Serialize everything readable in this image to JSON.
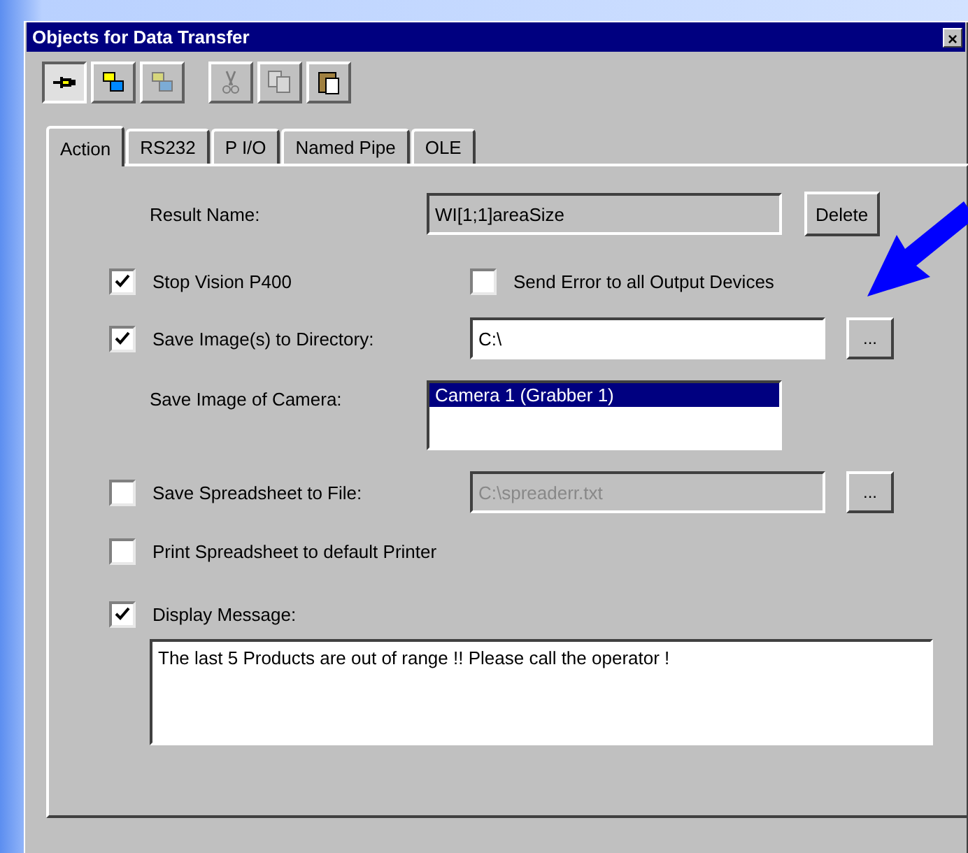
{
  "window": {
    "title": "Objects for Data Transfer",
    "close": "×"
  },
  "toolbar": [
    {
      "kind": "pin",
      "pressed": true,
      "disabled": false
    },
    {
      "kind": "tool",
      "pressed": false,
      "disabled": false
    },
    {
      "kind": "tool",
      "pressed": false,
      "disabled": true
    },
    {
      "kind": "cut",
      "pressed": false,
      "disabled": true
    },
    {
      "kind": "copy",
      "pressed": false,
      "disabled": true
    },
    {
      "kind": "paste",
      "pressed": false,
      "disabled": false
    }
  ],
  "tabs": [
    {
      "label": "Action",
      "selected": true
    },
    {
      "label": "RS232",
      "selected": false
    },
    {
      "label": "P I/O",
      "selected": false
    },
    {
      "label": "Named Pipe",
      "selected": false
    },
    {
      "label": "OLE",
      "selected": false
    }
  ],
  "result_name": {
    "label": "Result Name:",
    "value": "WI[1;1]areaSize",
    "button": "Delete"
  },
  "stop_vision": {
    "label": "Stop Vision P400",
    "checked": true
  },
  "send_error": {
    "label": "Send Error to all Output Devices",
    "checked": false
  },
  "save_images": {
    "label": "Save Image(s) to Directory:",
    "checked": true,
    "value": "C:\\",
    "disabled": false,
    "button": "..."
  },
  "camera": {
    "label": "Save Image of Camera:",
    "items": [
      {
        "label": "Camera 1  (Grabber 1)",
        "selected": true
      }
    ]
  },
  "save_spreadsheet": {
    "label": "Save Spreadsheet to File:",
    "checked": false,
    "value": "C:\\spreaderr.txt",
    "disabled": true,
    "button": "..."
  },
  "print_spreadsheet": {
    "label": "Print Spreadsheet to default Printer",
    "checked": false
  },
  "display_message": {
    "label": "Display Message:",
    "checked": true,
    "value": "The last 5 Products are out of range !! Please call the operator !"
  }
}
